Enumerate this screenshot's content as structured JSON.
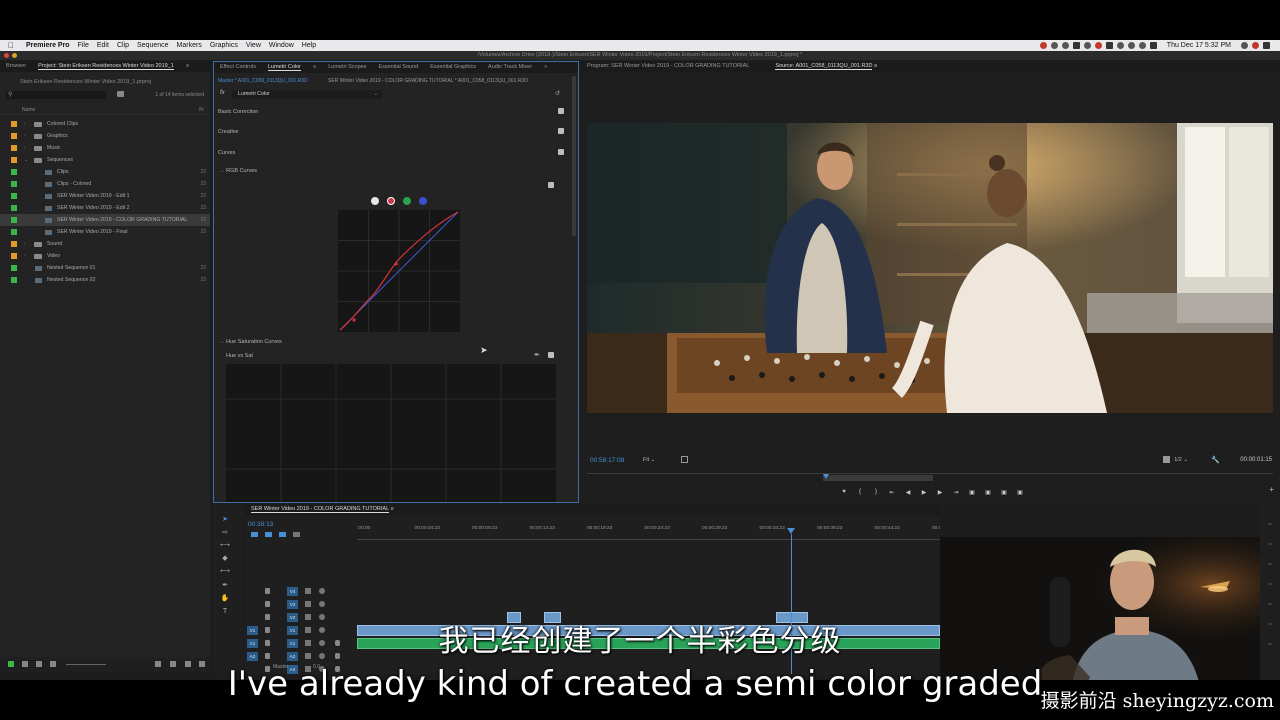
{
  "menubar": {
    "app_name": "Premiere Pro",
    "items": [
      "File",
      "Edit",
      "Clip",
      "Sequence",
      "Markers",
      "Graphics",
      "View",
      "Window",
      "Help"
    ],
    "clock": "Thu Dec 17  5:32 PM"
  },
  "window": {
    "path": "/Volumes/Archive Drive (2018-)/Stein Eriksen/SER Winter Video 2019/Project/Stein Eriksen Residences Winter Video 2019_1.prproj *"
  },
  "project_panel": {
    "tabs": [
      "Browser",
      "Project: Stein Eriksen Residences Winter Video 2019_1"
    ],
    "path": "Stein Eriksen Residences Winter Video 2019_1.prproj",
    "count": "1 of 14 items selected",
    "column_name": "Name",
    "column_fps": "Fr",
    "items": [
      {
        "label": "Colored Clips",
        "kind": "folder",
        "color": "#e39a2c",
        "fps": "",
        "indent": 0
      },
      {
        "label": "Graphics",
        "kind": "folder",
        "color": "#e39a2c",
        "fps": "",
        "indent": 0
      },
      {
        "label": "Music",
        "kind": "folder",
        "color": "#e39a2c",
        "fps": "",
        "indent": 0
      },
      {
        "label": "Sequences",
        "kind": "folder",
        "color": "#e39a2c",
        "fps": "",
        "indent": 0
      },
      {
        "label": "Clips",
        "kind": "sequence",
        "color": "#3cb54a",
        "fps": "23",
        "indent": 1
      },
      {
        "label": "Clips - Colored",
        "kind": "sequence",
        "color": "#3cb54a",
        "fps": "23",
        "indent": 1
      },
      {
        "label": "SER Winter Video 2019 - Edit 1",
        "kind": "sequence",
        "color": "#3cb54a",
        "fps": "23",
        "indent": 1
      },
      {
        "label": "SER Winter Video 2019 - Edit 2",
        "kind": "sequence",
        "color": "#3cb54a",
        "fps": "23",
        "indent": 1
      },
      {
        "label": "SER Winter Video 2019 - COLOR GRADING TUTORIAL",
        "kind": "sequence",
        "color": "#3cb54a",
        "fps": "23",
        "indent": 1
      },
      {
        "label": "SER Winter Video 2019 - Final",
        "kind": "sequence",
        "color": "#3cb54a",
        "fps": "23",
        "indent": 1
      },
      {
        "label": "Sound",
        "kind": "folder",
        "color": "#e39a2c",
        "fps": "",
        "indent": 0
      },
      {
        "label": "Video",
        "kind": "folder",
        "color": "#e39a2c",
        "fps": "",
        "indent": 0
      },
      {
        "label": "Nested Sequence 01",
        "kind": "sequence",
        "color": "#3cb54a",
        "fps": "23",
        "indent": 0
      },
      {
        "label": "Nested Sequence 02",
        "kind": "sequence",
        "color": "#3cb54a",
        "fps": "23",
        "indent": 0
      }
    ]
  },
  "lumetri_panel": {
    "tabs": [
      "Effect Controls",
      "Lumetri Color",
      "Lumetri Scopes",
      "Essential Sound",
      "Essential Graphics",
      "Audio Track Mixer"
    ],
    "master_clip": "Master * A001_C058_0113QU_001.R3D",
    "sequence_clip": "SER Winter Video 2019 - COLOR GRADING TUTORIAL * A001_C058_0113QU_001.R3D",
    "fx_label": "fx",
    "effect": "Lumetri Color",
    "sections": [
      "Basic Correction",
      "Creative",
      "Curves"
    ],
    "rgb_curves": "RGB Curves",
    "hue_sat_curves": "Hue Saturation Curves",
    "hue_vs_sat": "Hue vs Sat",
    "channel_colors": [
      "#e8e8e8",
      "#d0364a",
      "#2aa44a",
      "#3a4fd0"
    ]
  },
  "program_monitor": {
    "tabs": [
      "Program: SER Winter Video 2019 - COLOR GRADING TUTORIAL",
      "Source: A001_C058_0113QU_001.R3D"
    ],
    "timecode": "00:58:17:08",
    "fit": "Fit",
    "resolution": "1/2",
    "duration": "00:00:01:15"
  },
  "timeline": {
    "tab": "SER Winter Video 2019 - COLOR GRADING TUTORIAL",
    "timecode": "00:38:13",
    "ticks": [
      ":00:00",
      "00:00:04:23",
      "00:00:09:23",
      "00:00:14:23",
      "00:00:19:23",
      "00:00:24:23",
      "00:00:29:23",
      "00:00:34:23",
      "00:00:39:23",
      "00:00:44:22",
      "00:00:49:22"
    ],
    "video_tracks": [
      "V4",
      "V3",
      "V2",
      "V1"
    ],
    "audio_tracks": [
      "A1",
      "A2",
      "A3",
      "A4"
    ],
    "master": "Master",
    "master_val": "0.0"
  },
  "subtitles": {
    "chinese": "我已经创建了一个半彩色分级",
    "english": "I've already kind of created a semi color graded"
  },
  "watermark": "摄影前沿 sheyingzyz.com"
}
